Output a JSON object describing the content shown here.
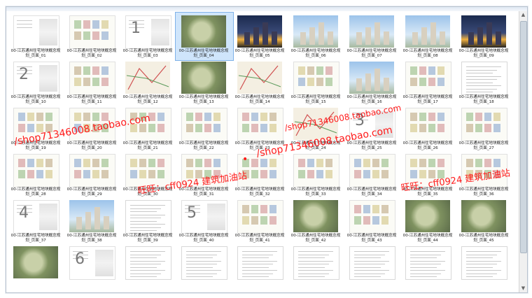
{
  "window": {
    "title": ""
  },
  "thumbnails": [
    {
      "caption": "00-江苏通州住宅地块概念规划_页面_01",
      "kind": "plain"
    },
    {
      "caption": "00-江苏通州住宅地块概念规划_页面_02",
      "kind": "plan"
    },
    {
      "caption": "00-江苏通州住宅地块概念规划_页面_03",
      "kind": "plain",
      "marker": "1"
    },
    {
      "caption": "00-江苏通州住宅地块概念规划_页面_04",
      "kind": "aerial",
      "selected": true
    },
    {
      "caption": "00-江苏通州住宅地块概念规划_页面_05",
      "kind": "night"
    },
    {
      "caption": "00-江苏通州住宅地块概念规划_页面_06",
      "kind": "sky"
    },
    {
      "caption": "00-江苏通州住宅地块概念规划_页面_07",
      "kind": "sky"
    },
    {
      "caption": "00-江苏通州住宅地块概念规划_页面_08",
      "kind": "sky"
    },
    {
      "caption": "00-江苏通州住宅地块概念规划_页面_09",
      "kind": "night"
    },
    {
      "caption": "00-江苏通州住宅地块概念规划_页面_10",
      "kind": "plain",
      "marker": "2"
    },
    {
      "caption": "00-江苏通州住宅地块概念规划_页面_11",
      "kind": "plan"
    },
    {
      "caption": "00-江苏通州住宅地块概念规划_页面_12",
      "kind": "map"
    },
    {
      "caption": "00-江苏通州住宅地块概念规划_页面_13",
      "kind": "aerial"
    },
    {
      "caption": "00-江苏通州住宅地块概念规划_页面_14",
      "kind": "map"
    },
    {
      "caption": "00-江苏通州住宅地块概念规划_页面_15",
      "kind": "plan"
    },
    {
      "caption": "00-江苏通州住宅地块概念规划_页面_16",
      "kind": "sky"
    },
    {
      "caption": "00-江苏通州住宅地块概念规划_页面_17",
      "kind": "plan"
    },
    {
      "caption": "00-江苏通州住宅地块概念规划_页面_18",
      "kind": "doc"
    },
    {
      "caption": "00-江苏通州住宅地块概念规划_页面_19",
      "kind": "plan"
    },
    {
      "caption": "00-江苏通州住宅地块概念规划_页面_20",
      "kind": "plan"
    },
    {
      "caption": "00-江苏通州住宅地块概念规划_页面_21",
      "kind": "plan"
    },
    {
      "caption": "00-江苏通州住宅地块概念规划_页面_22",
      "kind": "plan"
    },
    {
      "caption": "00-江苏通州住宅地块概念规划_页面_23",
      "kind": "plan"
    },
    {
      "caption": "00-江苏通州住宅地块概念规划_页面_24",
      "kind": "map"
    },
    {
      "caption": "00-江苏通州住宅地块概念规划_页面_25",
      "kind": "plain",
      "marker": "3"
    },
    {
      "caption": "00-江苏通州住宅地块概念规划_页面_26",
      "kind": "plan"
    },
    {
      "caption": "00-江苏通州住宅地块概念规划_页面_27",
      "kind": "plan"
    },
    {
      "caption": "00-江苏通州住宅地块概念规划_页面_28",
      "kind": "plan"
    },
    {
      "caption": "00-江苏通州住宅地块概念规划_页面_29",
      "kind": "plan"
    },
    {
      "caption": "00-江苏通州住宅地块概念规划_页面_30",
      "kind": "plan"
    },
    {
      "caption": "00-江苏通州住宅地块概念规划_页面_31",
      "kind": "plan"
    },
    {
      "caption": "00-江苏通州住宅地块概念规划_页面_32",
      "kind": "plan"
    },
    {
      "caption": "00-江苏通州住宅地块概念规划_页面_33",
      "kind": "plan"
    },
    {
      "caption": "00-江苏通州住宅地块概念规划_页面_34",
      "kind": "plan"
    },
    {
      "caption": "00-江苏通州住宅地块概念规划_页面_35",
      "kind": "plan"
    },
    {
      "caption": "00-江苏通州住宅地块概念规划_页面_36",
      "kind": "plan"
    },
    {
      "caption": "00-江苏通州住宅地块概念规划_页面_37",
      "kind": "plain",
      "marker": "4"
    },
    {
      "caption": "00-江苏通州住宅地块概念规划_页面_38",
      "kind": "sky"
    },
    {
      "caption": "00-江苏通州住宅地块概念规划_页面_39",
      "kind": "doc"
    },
    {
      "caption": "00-江苏通州住宅地块概念规划_页面_40",
      "kind": "plain",
      "marker": "5"
    },
    {
      "caption": "00-江苏通州住宅地块概念规划_页面_41",
      "kind": "plan"
    },
    {
      "caption": "00-江苏通州住宅地块概念规划_页面_42",
      "kind": "aerial"
    },
    {
      "caption": "00-江苏通州住宅地块概念规划_页面_43",
      "kind": "plan"
    },
    {
      "caption": "00-江苏通州住宅地块概念规划_页面_44",
      "kind": "aerial"
    },
    {
      "caption": "00-江苏通州住宅地块概念规划_页面_45",
      "kind": "aerial"
    },
    {
      "caption": "",
      "kind": "aerial"
    },
    {
      "caption": "",
      "kind": "plain",
      "marker": "6"
    },
    {
      "caption": "",
      "kind": "doc"
    },
    {
      "caption": "",
      "kind": "doc"
    },
    {
      "caption": "",
      "kind": "doc"
    },
    {
      "caption": "",
      "kind": "doc"
    },
    {
      "caption": "",
      "kind": "doc"
    },
    {
      "caption": "",
      "kind": "doc"
    },
    {
      "caption": "",
      "kind": "doc"
    }
  ],
  "watermarks": {
    "url_left": "/shop71346008.taobao.com",
    "url_mid": "/shop71346008.taobao.com",
    "url_right": "/shop71346008.taobao.com",
    "wangwang_left": "旺旺：cff0924  建筑加油站",
    "wangwang_right": "旺旺：cff0924  建筑加油站",
    "dot": "•"
  },
  "colors": {
    "watermark": "#ff1a1a",
    "selection": "#cfe5fb"
  }
}
